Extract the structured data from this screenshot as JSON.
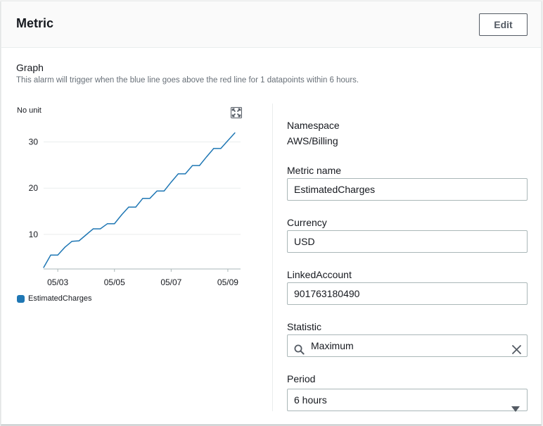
{
  "panel": {
    "title": "Metric",
    "edit_label": "Edit"
  },
  "graph": {
    "section_title": "Graph",
    "description": "This alarm will trigger when the blue line goes above the red line for 1 datapoints within 6 hours.",
    "unit_label": "No unit",
    "legend_label": "EstimatedCharges",
    "series_color": "#1f77b4",
    "expand_icon": "expand-icon"
  },
  "chart_data": {
    "type": "line",
    "title": "",
    "xlabel": "",
    "ylabel": "No unit",
    "x_tick_labels": [
      "05/03",
      "05/05",
      "05/07",
      "05/09"
    ],
    "y_ticks": [
      10,
      20,
      30
    ],
    "ylim": [
      2.5,
      33
    ],
    "grid": true,
    "legend": "bottom-left",
    "series": [
      {
        "name": "EstimatedCharges",
        "x": [
          "05/02 12:00",
          "05/02 18:00",
          "05/03 00:00",
          "05/03 06:00",
          "05/03 12:00",
          "05/03 18:00",
          "05/04 00:00",
          "05/04 06:00",
          "05/04 12:00",
          "05/04 18:00",
          "05/05 00:00",
          "05/05 06:00",
          "05/05 12:00",
          "05/05 18:00",
          "05/06 00:00",
          "05/06 06:00",
          "05/06 12:00",
          "05/06 18:00",
          "05/07 00:00",
          "05/07 06:00",
          "05/07 12:00",
          "05/07 18:00",
          "05/08 00:00",
          "05/08 06:00",
          "05/08 12:00",
          "05/08 18:00",
          "05/09 00:00",
          "05/09 06:00"
        ],
        "values": [
          2.8,
          5.5,
          5.5,
          7.2,
          8.5,
          8.6,
          9.9,
          11.2,
          11.2,
          12.3,
          12.3,
          14.2,
          15.9,
          15.9,
          17.8,
          17.8,
          19.4,
          19.4,
          21.3,
          23.1,
          23.1,
          24.9,
          24.9,
          26.8,
          28.6,
          28.6,
          30.3,
          32.0
        ]
      }
    ]
  },
  "fields": {
    "namespace_label": "Namespace",
    "namespace_value": "AWS/Billing",
    "metric_name_label": "Metric name",
    "metric_name_value": "EstimatedCharges",
    "currency_label": "Currency",
    "currency_value": "USD",
    "linked_account_label": "LinkedAccount",
    "linked_account_value": "901763180490",
    "statistic_label": "Statistic",
    "statistic_value": "Maximum",
    "period_label": "Period",
    "period_value": "6 hours"
  }
}
